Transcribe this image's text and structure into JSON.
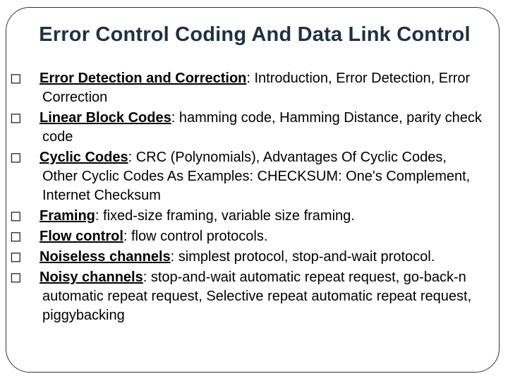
{
  "title": "Error Control Coding And Data Link Control",
  "bullet_glyph": "◻",
  "bullets": [
    {
      "topic": "Error Detection and Correction",
      "rest": ": Introduction, Error Detection, Error Correction"
    },
    {
      "topic": "Linear Block Codes",
      "rest": ": hamming code, Hamming Distance, parity check code"
    },
    {
      "topic": "Cyclic Codes",
      "rest": ": CRC (Polynomials), Advantages Of Cyclic Codes, Other Cyclic Codes As Examples: CHECKSUM: One's Complement, Internet Checksum"
    },
    {
      "topic": "Framing",
      "rest": ": fixed-size framing, variable size framing."
    },
    {
      "topic": "Flow control",
      "rest": ": flow control protocols."
    },
    {
      "topic": "Noiseless channels",
      "rest": ": simplest protocol, stop-and-wait protocol."
    },
    {
      "topic": "Noisy channels",
      "rest": ": stop-and-wait automatic repeat request, go-back-n automatic repeat request, Selective repeat automatic repeat request, piggybacking"
    }
  ]
}
